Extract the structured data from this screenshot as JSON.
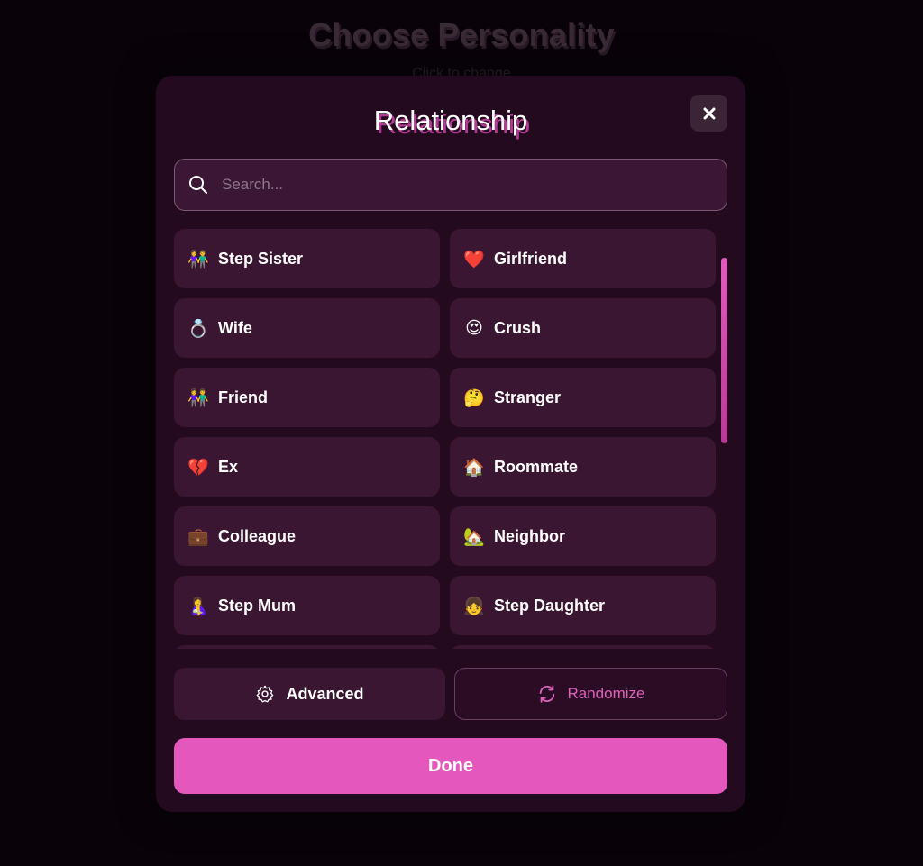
{
  "background": {
    "title": "Choose Personality",
    "subtitle": "Click to change"
  },
  "modal": {
    "title": "Relationship",
    "close_icon": "close-icon",
    "search": {
      "placeholder": "Search...",
      "value": ""
    },
    "items": [
      {
        "emoji": "👫",
        "label": "Step Sister"
      },
      {
        "emoji": "❤️",
        "label": "Girlfriend"
      },
      {
        "emoji": "💍",
        "label": "Wife"
      },
      {
        "emoji": "😍",
        "label": "Crush"
      },
      {
        "emoji": "👫",
        "label": "Friend"
      },
      {
        "emoji": "🤔",
        "label": "Stranger"
      },
      {
        "emoji": "💔",
        "label": "Ex"
      },
      {
        "emoji": "🏠",
        "label": "Roommate"
      },
      {
        "emoji": "💼",
        "label": "Colleague"
      },
      {
        "emoji": "🏡",
        "label": "Neighbor"
      },
      {
        "emoji": "🤱",
        "label": "Step Mum"
      },
      {
        "emoji": "👧",
        "label": "Step Daughter"
      },
      {
        "emoji": "",
        "label": ""
      },
      {
        "emoji": "",
        "label": ""
      }
    ],
    "advanced_label": "Advanced",
    "randomize_label": "Randomize",
    "done_label": "Done"
  },
  "colors": {
    "accent": "#e458be",
    "modal_bg": "#240a1f",
    "item_bg": "#3b1633"
  }
}
